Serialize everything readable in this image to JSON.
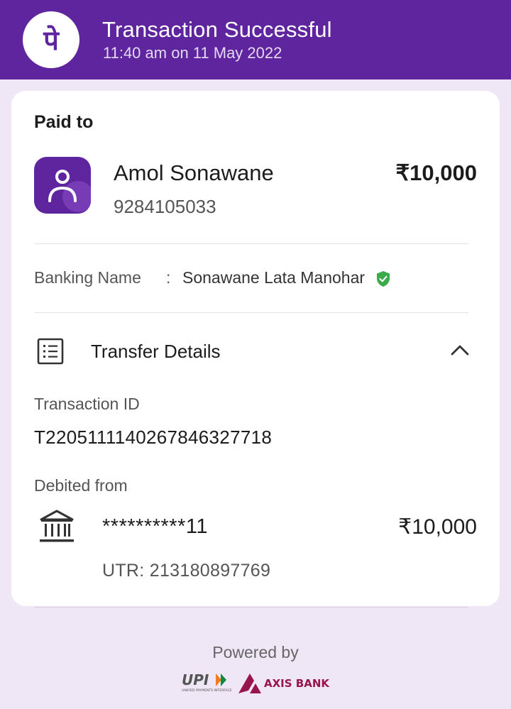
{
  "header": {
    "title": "Transaction Successful",
    "subtitle": "11:40 am on 11 May 2022",
    "logo_glyph": "पे",
    "color": "#5f259f"
  },
  "paid_to": {
    "label": "Paid to",
    "name": "Amol Sonawane",
    "phone": "9284105033",
    "amount": "₹10,000"
  },
  "banking": {
    "label": "Banking Name",
    "colon": ":",
    "value": "Sonawane Lata Manohar",
    "verified_icon": "verified-shield-icon",
    "verified_color": "#3aaa4a"
  },
  "transfer": {
    "label": "Transfer Details",
    "expanded": true,
    "transaction_id_label": "Transaction ID",
    "transaction_id": "T2205111140267846327718",
    "debited_label": "Debited from",
    "account": "**********11",
    "amount": "₹10,000",
    "utr": "UTR: 213180897769"
  },
  "footer": {
    "powered_by": "Powered by",
    "upi_text": "UPI",
    "upi_subtext": "UNIFIED PAYMENTS INTERFACE",
    "bank_name": "AXIS BANK",
    "bank_color": "#97144d"
  }
}
